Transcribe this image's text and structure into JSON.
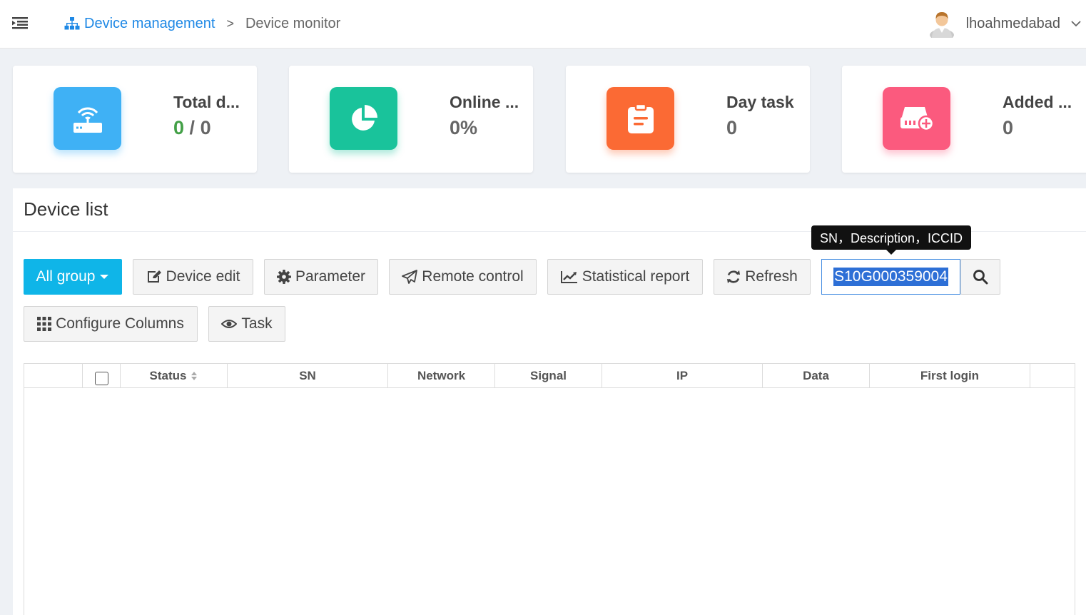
{
  "header": {
    "breadcrumb": {
      "parent": "Device management",
      "separator": ">",
      "current": "Device monitor"
    },
    "user": {
      "name": "lhoahmedabad"
    }
  },
  "cards": [
    {
      "title": "Total d...",
      "value_online": "0",
      "value_sep": "/",
      "value_total": "0",
      "icon": "router-icon",
      "color": "#3fb1f5"
    },
    {
      "title": "Online ...",
      "value": "0%",
      "icon": "pie-chart-icon",
      "color": "#19c39b"
    },
    {
      "title": "Day task",
      "value": "0",
      "icon": "clipboard-icon",
      "color": "#fb6a34"
    },
    {
      "title": "Added ...",
      "value": "0",
      "icon": "add-device-icon",
      "color": "#fb5a7e"
    }
  ],
  "device_list": {
    "title": "Device list",
    "toolbar": {
      "all_group": "All group",
      "device_edit": "Device edit",
      "parameter": "Parameter",
      "remote_control": "Remote control",
      "statistical_report": "Statistical report",
      "refresh": "Refresh",
      "configure_columns": "Configure Columns",
      "task": "Task"
    },
    "search": {
      "value": "S10G000359004",
      "tooltip": "SN，Description，ICCID"
    },
    "columns": [
      "Status",
      "SN",
      "Network",
      "Signal",
      "IP",
      "Data",
      "First login"
    ],
    "rows": []
  },
  "colors": {
    "accent": "#1e88e5",
    "primary_button": "#0fb5e8",
    "green": "#43a047"
  }
}
